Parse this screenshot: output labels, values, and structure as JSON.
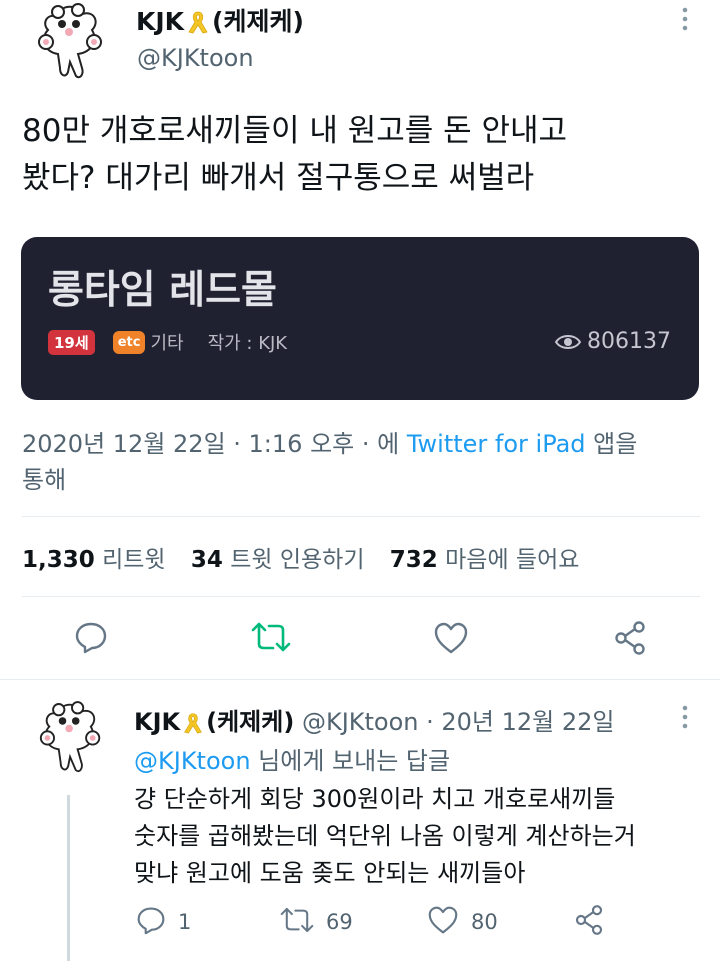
{
  "tweet": {
    "display_name": "KJK",
    "display_name_suffix": "(케제케)",
    "handle": "@KJKtoon",
    "text_line1": "80만 개호로새끼들이 내 원고를 돈 안내고",
    "text_line2": "봤다? 대가리 빠개서 절구통으로 써벌라",
    "card": {
      "title": "롱타임 레드몰",
      "age_badge": "19세",
      "genre_badge": "etc",
      "genre_label": "기타",
      "author": "작가 : KJK",
      "views": "806137"
    },
    "meta_prefix": "2020년 12월 22일 · 1:16 오후 · 에 ",
    "meta_app": "Twitter for iPad",
    "meta_suffix": " 앱을",
    "meta_line2": "통해",
    "stats": {
      "retweets_count": "1,330",
      "retweets_label": "리트윗",
      "quotes_count": "34",
      "quotes_label": "트윗 인용하기",
      "likes_count": "732",
      "likes_label": "마음에 들어요"
    }
  },
  "reply": {
    "display_name": "KJK",
    "display_name_suffix": "(케제케)",
    "handle_date": "@KJKtoon · 20년 12월 22일",
    "replying_to_handle": "@KJKtoon",
    "replying_to_text": " 님에게 보내는 답글",
    "text_line1": "걍 단순하게 회당 300원이라 치고 개호로새끼들",
    "text_line2": "숫자를 곱해봤는데 억단위 나옴 이렇게 계산하는거",
    "text_line3": "맞냐 원고에 도움 좆도 안되는 새끼들아",
    "reply_count": "1",
    "retweet_count": "69",
    "like_count": "80"
  },
  "icons": {
    "ribbon": "yellow-ribbon-icon",
    "more": "more-vertical-icon",
    "eye": "eye-icon",
    "reply": "reply-icon",
    "retweet": "retweet-icon",
    "like": "heart-icon",
    "share": "share-icon"
  },
  "colors": {
    "accent_blue": "#1d9bf0",
    "retweeted_green": "#00ba7c",
    "card_bg": "#1f2130",
    "badge_19": "#d2333d",
    "badge_etc": "#f0822a",
    "ribbon_yellow": "#f3c625"
  }
}
